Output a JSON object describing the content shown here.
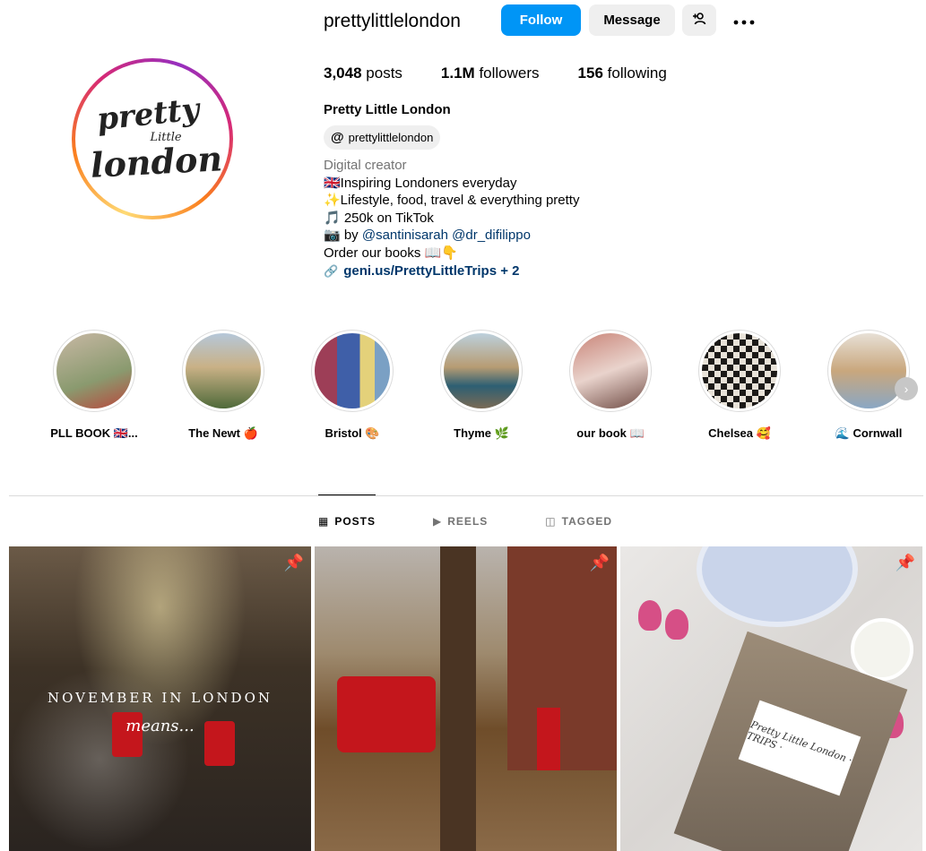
{
  "profile": {
    "username": "prettylittlelondon",
    "follow_label": "Follow",
    "message_label": "Message",
    "logo_line1": "pretty",
    "logo_line2": "Little",
    "logo_line3": "london",
    "posts_count": "3,048",
    "posts_label": "posts",
    "followers_count": "1.1M",
    "followers_label": "followers",
    "following_count": "156",
    "following_label": "following",
    "full_name": "Pretty Little London",
    "threads_handle": "prettylittlelondon",
    "category": "Digital creator",
    "bio_lines": [
      "🇬🇧Inspiring Londoners everyday",
      "✨Lifestyle, food, travel & everything pretty",
      "🎵 250k on TikTok",
      "📷 by",
      "Order our books 📖👇"
    ],
    "mention_1": "@santinisarah",
    "mention_2": "@dr_difilippo",
    "link": "geni.us/PrettyLittleTrips + 2"
  },
  "highlights": [
    {
      "label": "PLL BOOK 🇬🇧..."
    },
    {
      "label": "The Newt 🍎"
    },
    {
      "label": "Bristol 🎨"
    },
    {
      "label": "Thyme 🌿"
    },
    {
      "label": "our book 📖"
    },
    {
      "label": "Chelsea 🥰"
    },
    {
      "label": "🌊 Cornwall"
    }
  ],
  "tabs": {
    "posts": "POSTS",
    "reels": "REELS",
    "tagged": "TAGGED"
  },
  "posts": {
    "post1_title": "NOVEMBER IN LONDON",
    "post1_sub": "means...",
    "post3_card": "Pretty Little London · TRIPS ·"
  },
  "colors": {
    "follow_button": "#0095f6",
    "secondary_button": "#efefef",
    "link": "#00376b",
    "muted": "#737373"
  }
}
